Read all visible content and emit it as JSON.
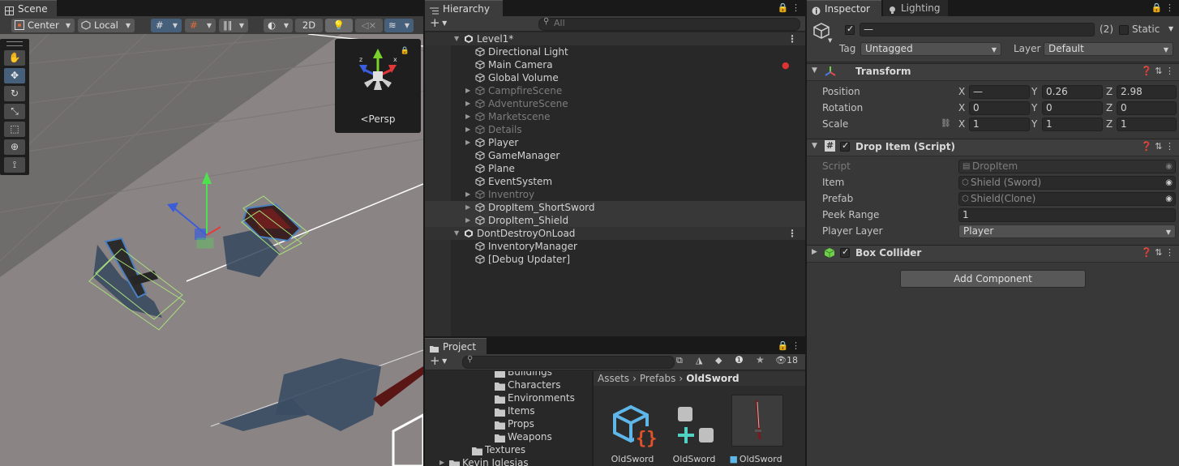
{
  "scene": {
    "tab": "Scene",
    "toolbar": {
      "pivot": "Center",
      "space": "Local",
      "mode_2d": "2D"
    },
    "gizmo_label": "Persp"
  },
  "hierarchy": {
    "tab": "Hierarchy",
    "search_placeholder": "All",
    "items": [
      {
        "label": "Level1*",
        "depth": 0,
        "type": "scene",
        "expanded": true
      },
      {
        "label": "Directional Light",
        "depth": 1
      },
      {
        "label": "Main Camera",
        "depth": 1
      },
      {
        "label": "Global Volume",
        "depth": 1
      },
      {
        "label": "CampfireScene",
        "depth": 1,
        "arrow": true,
        "dim": true
      },
      {
        "label": "AdventureScene",
        "depth": 1,
        "arrow": true,
        "dim": true
      },
      {
        "label": "Marketscene",
        "depth": 1,
        "arrow": true,
        "dim": true
      },
      {
        "label": "Details",
        "depth": 1,
        "arrow": true,
        "dim": true
      },
      {
        "label": "Player",
        "depth": 1,
        "arrow": true
      },
      {
        "label": "GameManager",
        "depth": 1
      },
      {
        "label": "Plane",
        "depth": 1
      },
      {
        "label": "EventSystem",
        "depth": 1
      },
      {
        "label": "Inventroy",
        "depth": 1,
        "arrow": true,
        "dim": true
      },
      {
        "label": "DropItem_ShortSword",
        "depth": 1,
        "arrow": true,
        "selected": true
      },
      {
        "label": "DropItem_Shield",
        "depth": 1,
        "arrow": true,
        "selected": true
      },
      {
        "label": "DontDestroyOnLoad",
        "depth": 0,
        "type": "scene",
        "expanded": true
      },
      {
        "label": "InventoryManager",
        "depth": 1
      },
      {
        "label": "[Debug Updater]",
        "depth": 1
      }
    ]
  },
  "project": {
    "tab": "Project",
    "hidden_count": "18",
    "folders": [
      {
        "label": "Buildings",
        "depth": 2
      },
      {
        "label": "Characters",
        "depth": 2
      },
      {
        "label": "Environments",
        "depth": 2
      },
      {
        "label": "Items",
        "depth": 2
      },
      {
        "label": "Props",
        "depth": 2
      },
      {
        "label": "Weapons",
        "depth": 2
      },
      {
        "label": "Textures",
        "depth": 1
      },
      {
        "label": "Kevin Iglesias",
        "depth": 0
      }
    ],
    "breadcrumb": [
      "Assets",
      "Prefabs",
      "OldSword"
    ],
    "assets": [
      {
        "label": "OldSword",
        "kind": "script"
      },
      {
        "label": "OldSword",
        "kind": "graph"
      },
      {
        "label": "OldSword",
        "kind": "prefab"
      }
    ]
  },
  "inspector": {
    "tabs": [
      "Inspector",
      "Lighting"
    ],
    "name_value": "—",
    "count": "(2)",
    "static_label": "Static",
    "tag_label": "Tag",
    "tag_value": "Untagged",
    "layer_label": "Layer",
    "layer_value": "Default",
    "transform": {
      "title": "Transform",
      "rows": [
        {
          "label": "Position",
          "x": "—",
          "y": "0.26",
          "z": "2.98"
        },
        {
          "label": "Rotation",
          "x": "0",
          "y": "0",
          "z": "0"
        },
        {
          "label": "Scale",
          "x": "1",
          "y": "1",
          "z": "1"
        }
      ]
    },
    "drop_item": {
      "title": "Drop Item (Script)",
      "script_label": "Script",
      "script_value": "DropItem",
      "item_label": "Item",
      "item_value": "Shield (Sword)",
      "prefab_label": "Prefab",
      "prefab_value": "Shield(Clone)",
      "peek_label": "Peek Range",
      "peek_value": "1",
      "player_layer_label": "Player Layer",
      "player_layer_value": "Player"
    },
    "box_collider": {
      "title": "Box Collider"
    },
    "add_component": "Add Component",
    "colors": {
      "accent": "#3a79bb",
      "bg": "#383838",
      "field": "#2a2a2a"
    }
  }
}
